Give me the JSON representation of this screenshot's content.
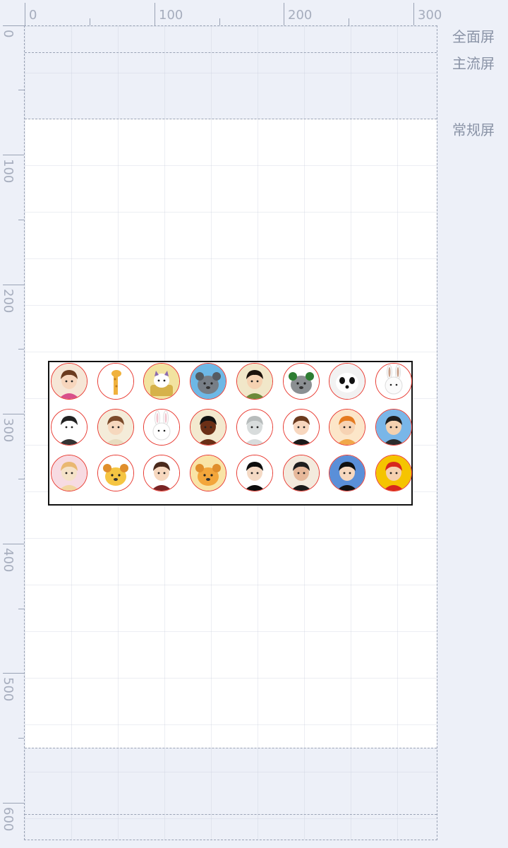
{
  "ruler": {
    "top_labels": [
      "0",
      "100",
      "200",
      "300"
    ],
    "left_labels": [
      "0",
      "100",
      "200",
      "300",
      "400",
      "500",
      "600"
    ]
  },
  "screen_guides": {
    "full": "全面屏",
    "main": "主流屏",
    "normal": "常规屏"
  },
  "avatars": [
    {
      "name": "avatar-girl-glasses-hat",
      "bg": "#f6e6d6",
      "skin": "#f7d6bd",
      "hair": "#6b3b1f",
      "shirt": "#d84f8a",
      "kind": "person"
    },
    {
      "name": "avatar-giraffe",
      "bg": "#ffffff",
      "skin": "#f0b23d",
      "hair": "#c07a1c",
      "shirt": "#f0b23d",
      "kind": "giraffe"
    },
    {
      "name": "avatar-cat-in-basket",
      "bg": "#f2e3a0",
      "skin": "#ffffff",
      "hair": "#8b6bb0",
      "shirt": "#d6b24a",
      "kind": "cat"
    },
    {
      "name": "avatar-bear-blue",
      "bg": "#6db8e6",
      "skin": "#777e86",
      "hair": "#555b61",
      "shirt": "#777e86",
      "kind": "animal"
    },
    {
      "name": "avatar-boy-bowl-cut",
      "bg": "#f1e7c9",
      "skin": "#f6d2b2",
      "hair": "#1c120b",
      "shirt": "#6c8a3a",
      "kind": "person"
    },
    {
      "name": "avatar-koala-green",
      "bg": "#ffffff",
      "skin": "#8b8f92",
      "hair": "#2e7d32",
      "shirt": "#8b8f92",
      "kind": "animal"
    },
    {
      "name": "avatar-panda-face",
      "bg": "#f2f2f2",
      "skin": "#ffffff",
      "hair": "#111111",
      "shirt": "#ffffff",
      "kind": "panda"
    },
    {
      "name": "avatar-rabbit-sketch",
      "bg": "#ffffff",
      "skin": "#fbfbfb",
      "hair": "#c9a08a",
      "shirt": "#fbfbfb",
      "kind": "rabbit"
    },
    {
      "name": "avatar-person-sketch",
      "bg": "#ffffff",
      "skin": "#ffffff",
      "hair": "#222222",
      "shirt": "#333333",
      "kind": "person"
    },
    {
      "name": "avatar-boy-brown-hair",
      "bg": "#f4ecd9",
      "skin": "#f6d8be",
      "hair": "#7a4a2a",
      "shirt": "#e8dcc0",
      "kind": "person"
    },
    {
      "name": "avatar-white-rabbit",
      "bg": "#ffffff",
      "skin": "#ffffff",
      "hair": "#f2c6cf",
      "shirt": "#ffffff",
      "kind": "rabbit"
    },
    {
      "name": "avatar-dark-figure",
      "bg": "#f3e9cf",
      "skin": "#6b2f16",
      "hair": "#111111",
      "shirt": "#6b2f16",
      "kind": "person"
    },
    {
      "name": "avatar-ghost-gray",
      "bg": "#ffffff",
      "skin": "#d8dcdc",
      "hair": "#b7bcbc",
      "shirt": "#d8dcdc",
      "kind": "person"
    },
    {
      "name": "avatar-boy-big-eyes",
      "bg": "#ffffff",
      "skin": "#f7d7bf",
      "hair": "#6a3a1e",
      "shirt": "#1a1a1a",
      "kind": "person"
    },
    {
      "name": "avatar-girl-orange-hair",
      "bg": "#fce6c9",
      "skin": "#f7d3b3",
      "hair": "#e57b1f",
      "shirt": "#f1a84a",
      "kind": "person"
    },
    {
      "name": "avatar-man-glasses-blue",
      "bg": "#79b6e8",
      "skin": "#f3d1b0",
      "hair": "#1e1e1e",
      "shirt": "#2c2c2c",
      "kind": "person"
    },
    {
      "name": "avatar-girl-pink",
      "bg": "#f7dbe2",
      "skin": "#f5e2c8",
      "hair": "#e9b871",
      "shirt": "#f2d6a0",
      "kind": "person"
    },
    {
      "name": "avatar-yellow-creature",
      "bg": "#ffffff",
      "skin": "#f5c542",
      "hair": "#e08e2b",
      "shirt": "#f5c542",
      "kind": "animal"
    },
    {
      "name": "avatar-girl-brown-hair",
      "bg": "#ffffff",
      "skin": "#f7d8bf",
      "hair": "#4a2a1c",
      "shirt": "#7a2424",
      "kind": "person"
    },
    {
      "name": "avatar-orange-bear",
      "bg": "#f9e4a6",
      "skin": "#f3a63b",
      "hair": "#e08e2b",
      "shirt": "#f3a63b",
      "kind": "animal"
    },
    {
      "name": "avatar-long-hair-girl",
      "bg": "#ffffff",
      "skin": "#f4d9c4",
      "hair": "#0d0d0d",
      "shirt": "#0d0d0d",
      "kind": "person"
    },
    {
      "name": "avatar-man-black-coat",
      "bg": "#f3eadd",
      "skin": "#e6b89a",
      "hair": "#1e1e1e",
      "shirt": "#1a1a1a",
      "kind": "person"
    },
    {
      "name": "avatar-boy-blue-pattern",
      "bg": "#5a8fd8",
      "skin": "#f7d8bf",
      "hair": "#111111",
      "shirt": "#111111",
      "kind": "person"
    },
    {
      "name": "avatar-red-hat",
      "bg": "#f5c400",
      "skin": "#f5d0b0",
      "hair": "#d7261e",
      "shirt": "#d7261e",
      "kind": "person"
    }
  ]
}
